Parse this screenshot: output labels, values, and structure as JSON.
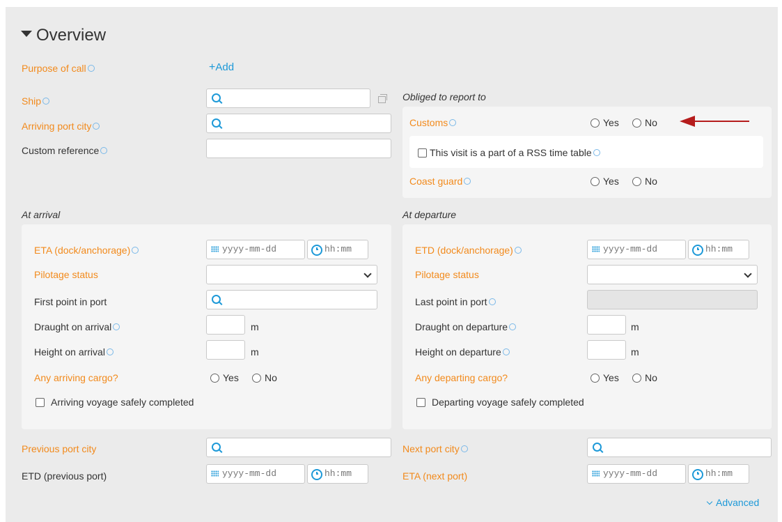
{
  "header": {
    "title": "Overview"
  },
  "top": {
    "purpose_label": "Purpose of call",
    "add_label": "Add",
    "ship_label": "Ship",
    "arriving_city_label": "Arriving port city",
    "custom_ref_label": "Custom reference",
    "custom_ref_value": ""
  },
  "report": {
    "heading": "Obliged to report to",
    "customs_label": "Customs",
    "yes": "Yes",
    "no": "No",
    "rss_label": "This visit is a part of a RSS time table",
    "coast_guard_label": "Coast guard"
  },
  "arrival": {
    "heading": "At arrival",
    "eta_label": "ETA (dock/anchorage)",
    "date_placeholder": "yyyy-mm-dd",
    "time_placeholder": "hh:mm",
    "pilotage_label": "Pilotage status",
    "pilotage_value": "",
    "first_point_label": "First point in port",
    "draught_label": "Draught on arrival",
    "height_label": "Height on arrival",
    "unit_m": "m",
    "cargo_label": "Any arriving cargo?",
    "yes": "Yes",
    "no": "No",
    "voyage_label": "Arriving voyage safely completed"
  },
  "departure": {
    "heading": "At departure",
    "etd_label": "ETD (dock/anchorage)",
    "date_placeholder": "yyyy-mm-dd",
    "time_placeholder": "hh:mm",
    "pilotage_label": "Pilotage status",
    "pilotage_value": "",
    "last_point_label": "Last point in port",
    "draught_label": "Draught on departure",
    "height_label": "Height on departure",
    "unit_m": "m",
    "cargo_label": "Any departing cargo?",
    "yes": "Yes",
    "no": "No",
    "voyage_label": "Departing voyage safely completed"
  },
  "bottom": {
    "previous_city_label": "Previous port city",
    "etd_previous_label": "ETD (previous port)",
    "next_city_label": "Next port city",
    "eta_next_label": "ETA (next port)",
    "date_placeholder": "yyyy-mm-dd",
    "time_placeholder": "hh:mm",
    "advanced_label": "Advanced"
  },
  "colors": {
    "accent": "#1d99d8",
    "required_label": "#f28a1c",
    "arrow": "#b51c1c",
    "panel_bg": "#ebebeb"
  }
}
